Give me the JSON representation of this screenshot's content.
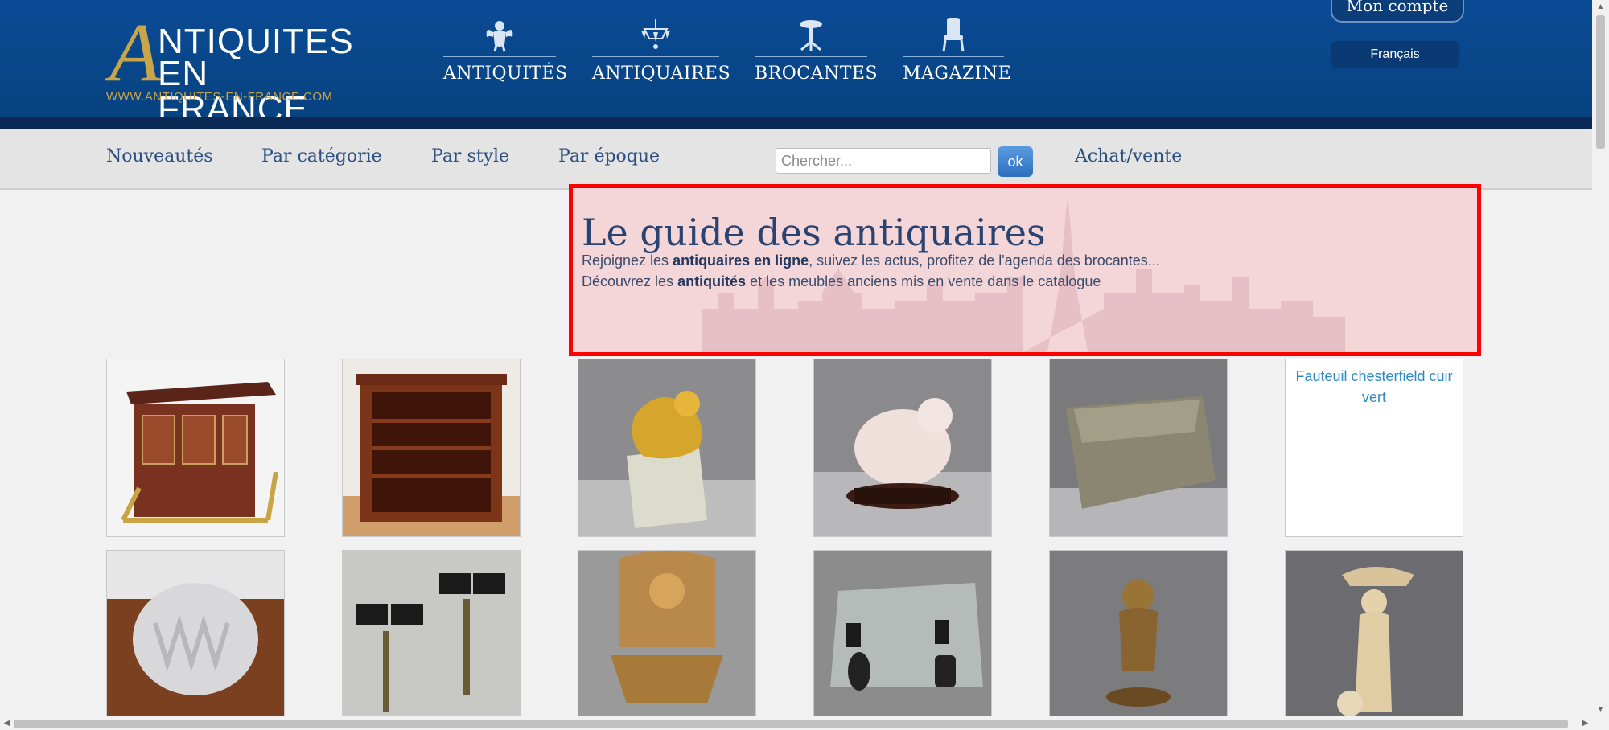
{
  "header": {
    "logo": {
      "big_letter": "A",
      "line1": "NTIQUITES",
      "line2": "EN FRANCE",
      "url": "WWW.ANTIQUITES-EN-FRANCE.COM"
    },
    "nav": [
      {
        "label": "ANTIQUITÉS",
        "icon": "cherub-icon"
      },
      {
        "label": "ANTIQUAIRES",
        "icon": "chandelier-icon"
      },
      {
        "label": "BROCANTES",
        "icon": "table-icon"
      },
      {
        "label": "MAGAZINE",
        "icon": "chair-icon"
      }
    ],
    "account_label": "Mon compte",
    "language": "Français"
  },
  "subnav": {
    "links": [
      "Nouveautés",
      "Par catégorie",
      "Par style",
      "Par époque",
      "Achat/vente"
    ],
    "search_placeholder": "Chercher...",
    "search_button": "ok"
  },
  "hero": {
    "title": "Le guide des antiquaires",
    "line1": {
      "before": "Rejoignez les ",
      "bold": "antiquaires en ligne",
      "after": ", suivez les actus, profitez de l'agenda des brocantes..."
    },
    "line2": {
      "before": "Découvrez les ",
      "bold": "antiquités",
      "after": " et les meubles anciens mis en vente dans le catalogue"
    }
  },
  "products": {
    "row1": [
      {
        "name": "bar-cabinet-image"
      },
      {
        "name": "bookcase-image"
      },
      {
        "name": "gilded-lion-image"
      },
      {
        "name": "rose-quartz-sculpture-image"
      },
      {
        "name": "stone-trough-image"
      },
      {
        "name": "chesterfield-image",
        "alt": "Fauteuil chesterfield cuir vert"
      }
    ],
    "row2": [
      {
        "name": "crystal-vase-image"
      },
      {
        "name": "wall-sconces-image"
      },
      {
        "name": "carved-fountain-image"
      },
      {
        "name": "glass-table-image"
      },
      {
        "name": "bronze-cherub-image"
      },
      {
        "name": "ivory-statue-image"
      }
    ]
  },
  "colors": {
    "header_blue": "#0b4b95",
    "gold": "#c8a548",
    "link_blue": "#2a4f80",
    "hero_highlight": "#ff0000"
  }
}
